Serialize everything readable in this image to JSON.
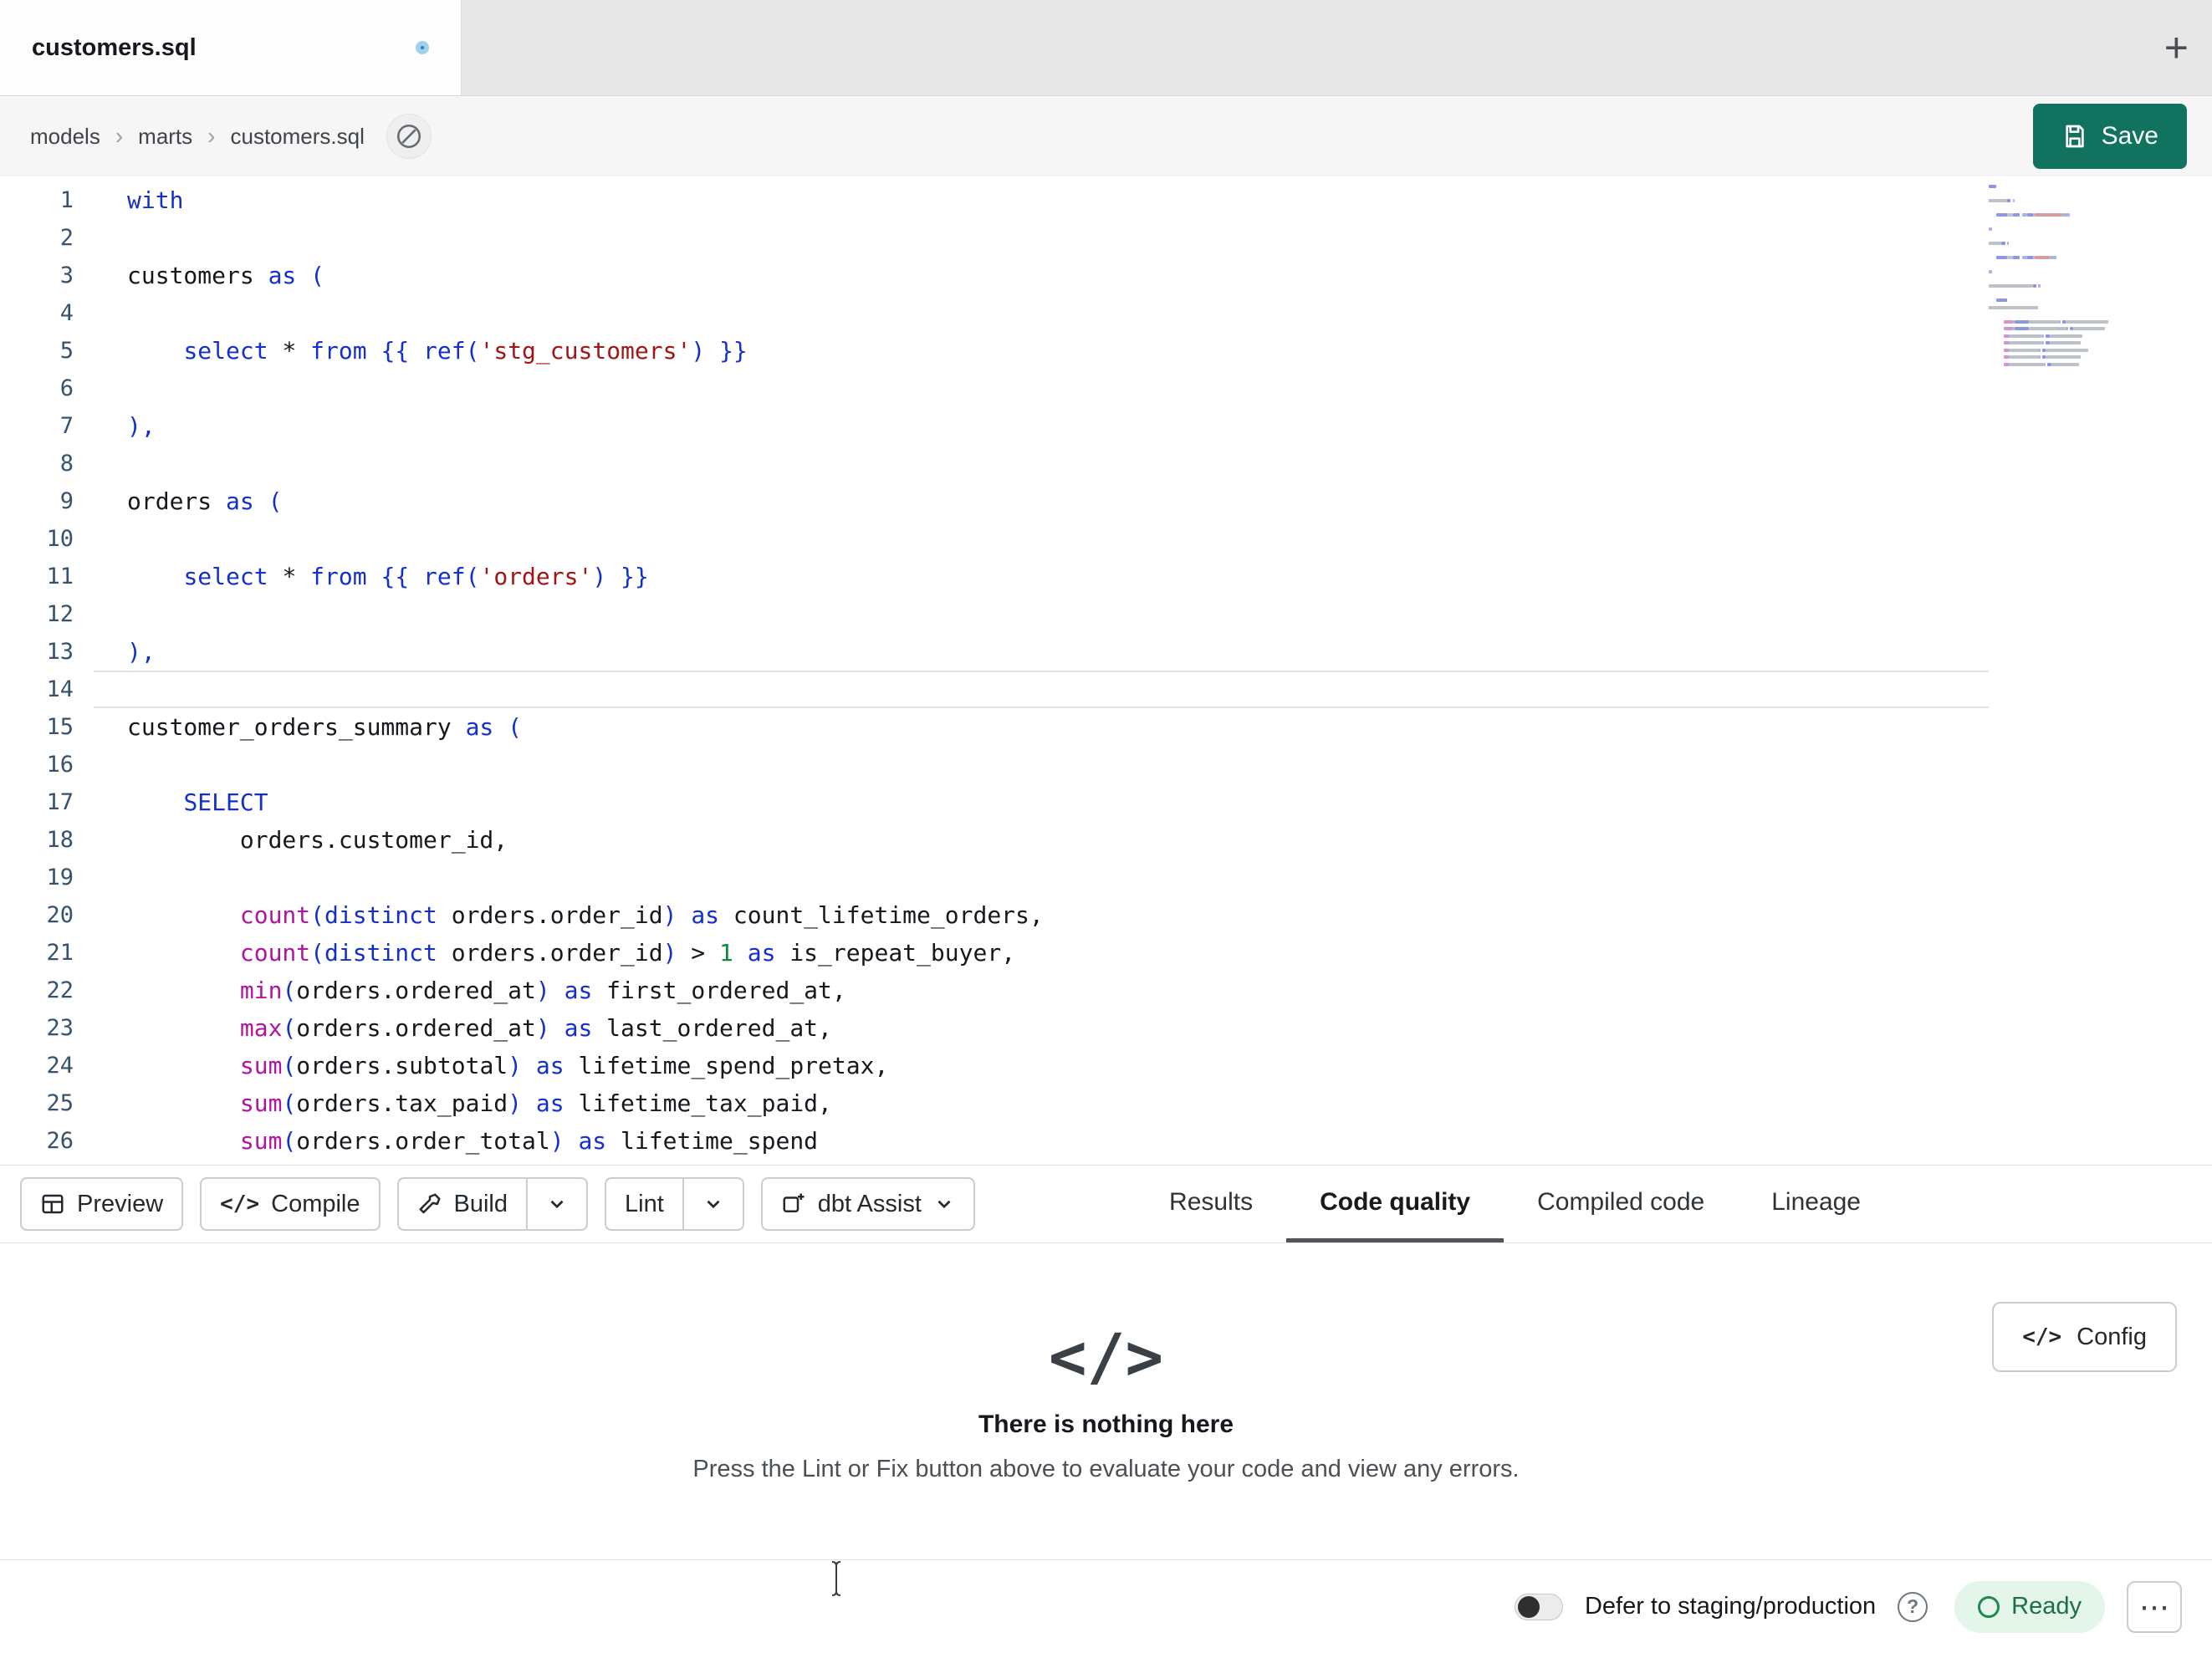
{
  "colors": {
    "accent_save": "#11735f",
    "keyword": "#1430cc",
    "function": "#b014a0",
    "string": "#a31515",
    "number": "#0f8a3d"
  },
  "tab_bar": {
    "active_tab_title": "customers.sql",
    "new_tab_label": "+"
  },
  "breadcrumb": {
    "items": [
      "models",
      "marts",
      "customers.sql"
    ],
    "separator": "›"
  },
  "actions": {
    "save_label": "Save"
  },
  "editor": {
    "active_line": 14,
    "lines": [
      {
        "n": 1,
        "tokens": [
          [
            "kw",
            "with"
          ]
        ]
      },
      {
        "n": 2,
        "tokens": []
      },
      {
        "n": 3,
        "tokens": [
          [
            "pl",
            "customers "
          ],
          [
            "kw",
            "as"
          ],
          [
            "pl",
            " "
          ],
          [
            "pu",
            "("
          ]
        ]
      },
      {
        "n": 4,
        "tokens": []
      },
      {
        "n": 5,
        "tokens": [
          [
            "pl",
            "    "
          ],
          [
            "kw",
            "select"
          ],
          [
            "pl",
            " * "
          ],
          [
            "kw",
            "from"
          ],
          [
            "pl",
            " "
          ],
          [
            "pu",
            "{{ "
          ],
          [
            "kw",
            "ref"
          ],
          [
            "pu",
            "("
          ],
          [
            "str",
            "'stg_customers'"
          ],
          [
            "pu",
            ") }}"
          ]
        ]
      },
      {
        "n": 6,
        "tokens": []
      },
      {
        "n": 7,
        "tokens": [
          [
            "pu",
            "),"
          ]
        ]
      },
      {
        "n": 8,
        "tokens": []
      },
      {
        "n": 9,
        "tokens": [
          [
            "pl",
            "orders "
          ],
          [
            "kw",
            "as"
          ],
          [
            "pl",
            " "
          ],
          [
            "pu",
            "("
          ]
        ]
      },
      {
        "n": 10,
        "tokens": []
      },
      {
        "n": 11,
        "tokens": [
          [
            "pl",
            "    "
          ],
          [
            "kw",
            "select"
          ],
          [
            "pl",
            " * "
          ],
          [
            "kw",
            "from"
          ],
          [
            "pl",
            " "
          ],
          [
            "pu",
            "{{ "
          ],
          [
            "kw",
            "ref"
          ],
          [
            "pu",
            "("
          ],
          [
            "str",
            "'orders'"
          ],
          [
            "pu",
            ") }}"
          ]
        ]
      },
      {
        "n": 12,
        "tokens": []
      },
      {
        "n": 13,
        "tokens": [
          [
            "pu",
            "),"
          ]
        ]
      },
      {
        "n": 14,
        "tokens": []
      },
      {
        "n": 15,
        "tokens": [
          [
            "pl",
            "customer_orders_summary "
          ],
          [
            "kw",
            "as"
          ],
          [
            "pl",
            " "
          ],
          [
            "pu",
            "("
          ]
        ]
      },
      {
        "n": 16,
        "tokens": []
      },
      {
        "n": 17,
        "tokens": [
          [
            "pl",
            "    "
          ],
          [
            "kw",
            "SELECT"
          ]
        ]
      },
      {
        "n": 18,
        "tokens": [
          [
            "pl",
            "        orders.customer_id,"
          ]
        ]
      },
      {
        "n": 19,
        "tokens": []
      },
      {
        "n": 20,
        "tokens": [
          [
            "pl",
            "        "
          ],
          [
            "fn",
            "count"
          ],
          [
            "pu",
            "("
          ],
          [
            "kw",
            "distinct"
          ],
          [
            "pl",
            " orders.order_id"
          ],
          [
            "pu",
            ")"
          ],
          [
            "pl",
            " "
          ],
          [
            "kw",
            "as"
          ],
          [
            "pl",
            " count_lifetime_orders,"
          ]
        ]
      },
      {
        "n": 21,
        "tokens": [
          [
            "pl",
            "        "
          ],
          [
            "fn",
            "count"
          ],
          [
            "pu",
            "("
          ],
          [
            "kw",
            "distinct"
          ],
          [
            "pl",
            " orders.order_id"
          ],
          [
            "pu",
            ")"
          ],
          [
            "pl",
            " > "
          ],
          [
            "num",
            "1"
          ],
          [
            "pl",
            " "
          ],
          [
            "kw",
            "as"
          ],
          [
            "pl",
            " is_repeat_buyer,"
          ]
        ]
      },
      {
        "n": 22,
        "tokens": [
          [
            "pl",
            "        "
          ],
          [
            "fn",
            "min"
          ],
          [
            "pu",
            "("
          ],
          [
            "pl",
            "orders.ordered_at"
          ],
          [
            "pu",
            ")"
          ],
          [
            "pl",
            " "
          ],
          [
            "kw",
            "as"
          ],
          [
            "pl",
            " first_ordered_at,"
          ]
        ]
      },
      {
        "n": 23,
        "tokens": [
          [
            "pl",
            "        "
          ],
          [
            "fn",
            "max"
          ],
          [
            "pu",
            "("
          ],
          [
            "pl",
            "orders.ordered_at"
          ],
          [
            "pu",
            ")"
          ],
          [
            "pl",
            " "
          ],
          [
            "kw",
            "as"
          ],
          [
            "pl",
            " last_ordered_at,"
          ]
        ]
      },
      {
        "n": 24,
        "tokens": [
          [
            "pl",
            "        "
          ],
          [
            "fn",
            "sum"
          ],
          [
            "pu",
            "("
          ],
          [
            "pl",
            "orders.subtotal"
          ],
          [
            "pu",
            ")"
          ],
          [
            "pl",
            " "
          ],
          [
            "kw",
            "as"
          ],
          [
            "pl",
            " lifetime_spend_pretax,"
          ]
        ]
      },
      {
        "n": 25,
        "tokens": [
          [
            "pl",
            "        "
          ],
          [
            "fn",
            "sum"
          ],
          [
            "pu",
            "("
          ],
          [
            "pl",
            "orders.tax_paid"
          ],
          [
            "pu",
            ")"
          ],
          [
            "pl",
            " "
          ],
          [
            "kw",
            "as"
          ],
          [
            "pl",
            " lifetime_tax_paid,"
          ]
        ]
      },
      {
        "n": 26,
        "tokens": [
          [
            "pl",
            "        "
          ],
          [
            "fn",
            "sum"
          ],
          [
            "pu",
            "("
          ],
          [
            "pl",
            "orders.order_total"
          ],
          [
            "pu",
            ")"
          ],
          [
            "pl",
            " "
          ],
          [
            "kw",
            "as"
          ],
          [
            "pl",
            " lifetime_spend"
          ]
        ]
      }
    ]
  },
  "toolbar": {
    "preview_label": "Preview",
    "compile_label": "Compile",
    "compile_icon": "</>",
    "build_label": "Build",
    "lint_label": "Lint",
    "assist_label": "dbt Assist"
  },
  "panel_tabs": [
    {
      "label": "Results"
    },
    {
      "label": "Code quality"
    },
    {
      "label": "Compiled code"
    },
    {
      "label": "Lineage"
    }
  ],
  "empty_state": {
    "icon": "</>",
    "title": "There is nothing here",
    "subtitle": "Press the Lint or Fix button above to evaluate your code and view any errors.",
    "config_icon": "</>",
    "config_label": "Config"
  },
  "status_bar": {
    "defer_label": "Defer to staging/production",
    "help_icon": "?",
    "ready_label": "Ready",
    "more_icon": "⋯"
  }
}
